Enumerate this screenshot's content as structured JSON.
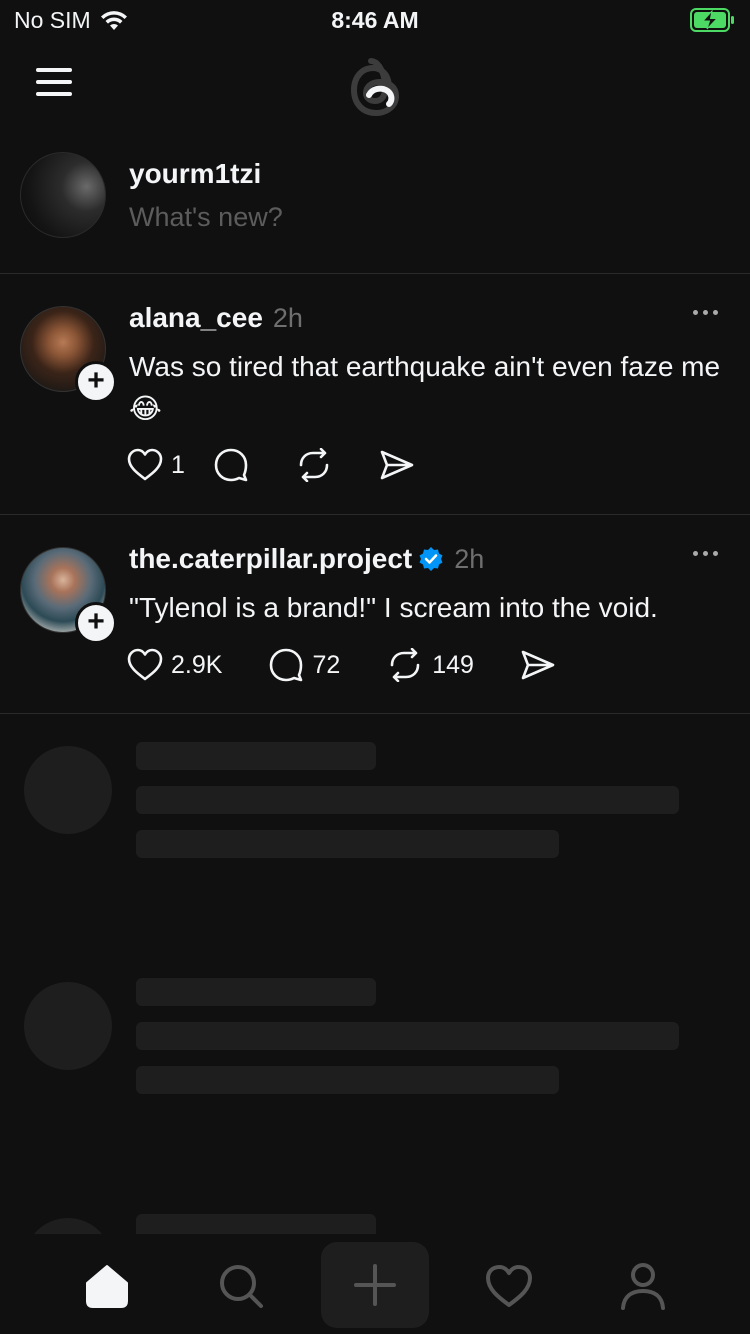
{
  "status_bar": {
    "carrier": "No SIM",
    "time": "8:46 AM"
  },
  "app": {
    "name": "Threads",
    "accent": "#f3f5f7",
    "verified_color": "#0095f6",
    "background": "#101010"
  },
  "composer": {
    "username": "yourm1tzi",
    "placeholder": "What's new?"
  },
  "posts": [
    {
      "username": "alana_cee",
      "time": "2h",
      "verified": false,
      "text": "Was so tired that earthquake ain't even faze me 😂",
      "likes": "1",
      "replies": "",
      "reposts": ""
    },
    {
      "username": "the.caterpillar.project",
      "time": "2h",
      "verified": true,
      "text": "\"Tylenol is a brand!\" I scream into the void.",
      "likes": "2.9K",
      "replies": "72",
      "reposts": "149"
    }
  ],
  "nav": {
    "items": [
      {
        "name": "home",
        "icon": "home-icon",
        "active": true
      },
      {
        "name": "search",
        "icon": "search-icon",
        "active": false
      },
      {
        "name": "compose",
        "icon": "plus-icon",
        "active": false
      },
      {
        "name": "activity",
        "icon": "heart-icon",
        "active": false
      },
      {
        "name": "profile",
        "icon": "person-icon",
        "active": false
      }
    ]
  }
}
